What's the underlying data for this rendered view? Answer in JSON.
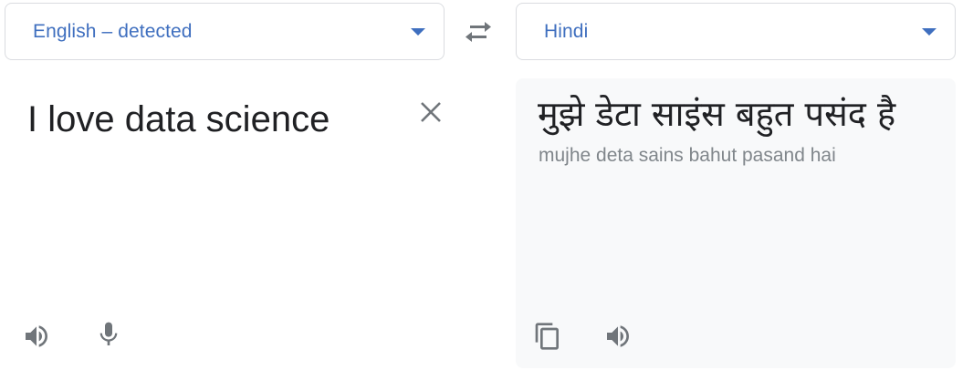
{
  "source_language": {
    "label": "English – detected"
  },
  "target_language": {
    "label": "Hindi"
  },
  "source": {
    "text": "I love data science"
  },
  "target": {
    "translation": "मुझे डेटा साइंस बहुत पसंद है",
    "transliteration": "mujhe deta sains bahut pasand hai"
  },
  "colors": {
    "accent": "#3f6fbf",
    "text_primary": "#202124",
    "text_secondary": "#80868b",
    "icon": "#70757a",
    "panel_bg": "#f8f9fa",
    "border": "#dadce0"
  },
  "icons": {
    "swap": "swap-horiz-icon",
    "clear": "close-icon",
    "listen_source": "volume-icon",
    "mic": "microphone-icon",
    "copy": "copy-icon",
    "listen_target": "volume-icon"
  }
}
